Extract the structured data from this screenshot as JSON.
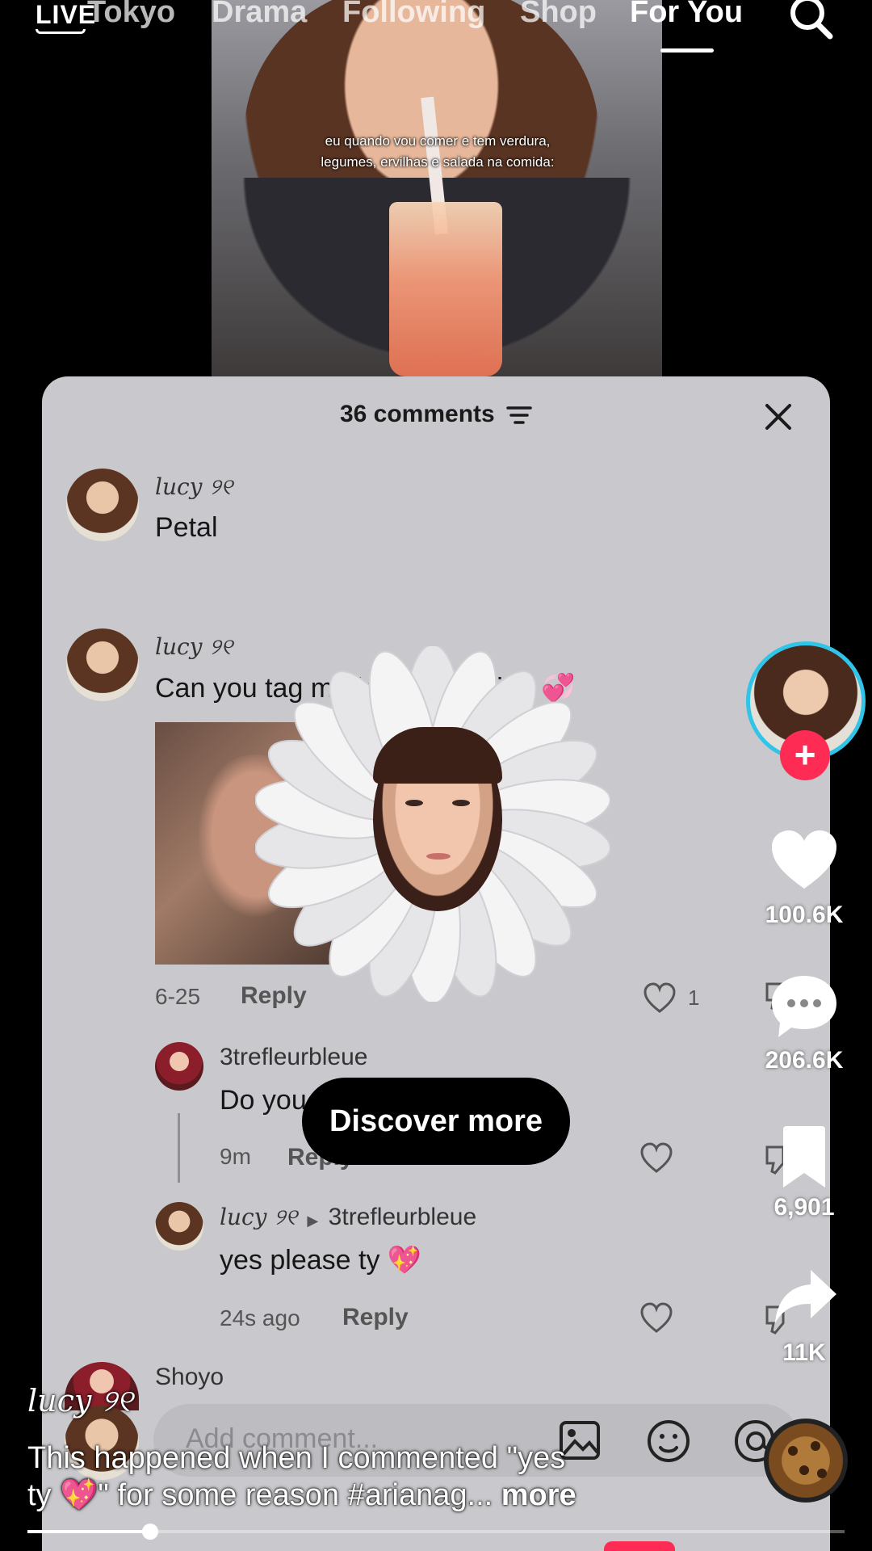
{
  "top_nav": {
    "live_label": "LIVE",
    "tabs": [
      {
        "label": "Tokyo"
      },
      {
        "label": "Drama"
      },
      {
        "label": "Following"
      },
      {
        "label": "Shop"
      },
      {
        "label": "For You"
      }
    ],
    "active_tab": "For You",
    "search_icon": "search-icon"
  },
  "video": {
    "caption_line1": "eu quando vou comer e tem verdura,",
    "caption_line2": "legumes, ervilhas e salada na comida:"
  },
  "comments_panel": {
    "title": "36 comments",
    "sort_icon": "sort-icon",
    "close_icon": "close-icon",
    "comments": [
      {
        "username": "lucy ୨୧",
        "text": "Petal"
      },
      {
        "username": "lucy ୨୧",
        "text": "Can you tag me in the first vid? 💞",
        "date": "6-25",
        "reply_label": "Reply",
        "likes": "1"
      }
    ],
    "replies": [
      {
        "username": "3trefleurbleue",
        "text": "Do you want it? it's late😭",
        "time": "9m",
        "reply_label": "Reply"
      },
      {
        "username": "lucy ୨୧",
        "reply_to": "3trefleurbleue",
        "text": "yes please ty 💖",
        "time": "24s ago",
        "reply_label": "Reply"
      }
    ],
    "partial_username": "Shoyo",
    "add_comment_placeholder": "Add comment..."
  },
  "discover_more": "Discover more",
  "actions": {
    "likes": "100.6K",
    "comments": "206.6K",
    "saves": "6,901",
    "shares": "11K",
    "follow_symbol": "+"
  },
  "post": {
    "creator": "lucy ୨୧",
    "caption_line1": "This happened when I commented \"yes",
    "caption_line2": "ty 💖\" for some reason #arianag...",
    "more_label": "more"
  },
  "playback": {
    "progress": 0.15
  },
  "colors": {
    "accent": "#fe2c55",
    "avatar_ring": "#30c5e8",
    "sheet_bg": "#c9c9cd"
  }
}
